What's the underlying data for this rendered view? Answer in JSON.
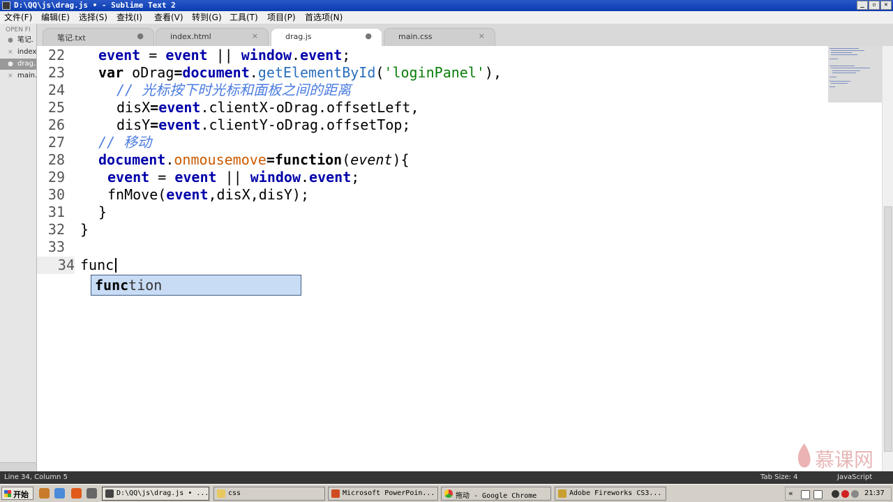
{
  "window": {
    "title": "D:\\QQ\\js\\drag.js • - Sublime Text 2",
    "controls": [
      "_",
      "▫",
      "✕"
    ]
  },
  "menu": [
    "文件(F)",
    "编辑(E)",
    "选择(S)",
    "查找(I)",
    "查看(V)",
    "转到(G)",
    "工具(T)",
    "项目(P)",
    "首选项(N)"
  ],
  "sidebar": {
    "header": "OPEN FI",
    "items": [
      {
        "label": "笔记.",
        "mark": "●"
      },
      {
        "label": "index",
        "mark": "×"
      },
      {
        "label": "drag.",
        "mark": "●"
      },
      {
        "label": "main.",
        "mark": "×"
      }
    ]
  },
  "tabs": [
    {
      "label": "笔记.txt",
      "control": "●"
    },
    {
      "label": "index.html",
      "control": "×"
    },
    {
      "label": "drag.js",
      "control": "●"
    },
    {
      "label": "main.css",
      "control": "×"
    }
  ],
  "editor": {
    "line_numbers": [
      "22",
      "23",
      "24",
      "25",
      "26",
      "27",
      "28",
      "29",
      "30",
      "31",
      "32",
      "33",
      "34"
    ],
    "typed": "func",
    "autocomplete": {
      "match": "func",
      "rest": "tion"
    }
  },
  "statusbar": {
    "position": "Line 34, Column 5",
    "tab_size": "Tab Size: 4",
    "syntax": "JavaScript"
  },
  "watermark": "慕课网",
  "taskbar": {
    "start": "开始",
    "tasks": [
      "D:\\QQ\\js\\drag.js • ...",
      "css",
      "Microsoft PowerPoin...",
      "拖动 - Google Chrome",
      "Adobe Fireworks CS3..."
    ],
    "clock": "21:37"
  },
  "colors": {
    "keyword": "#0000aa",
    "function_name": "#2a6fbd",
    "string": "#0a7d0a",
    "property": "#cc5a00",
    "comment": "#4a7be0"
  }
}
